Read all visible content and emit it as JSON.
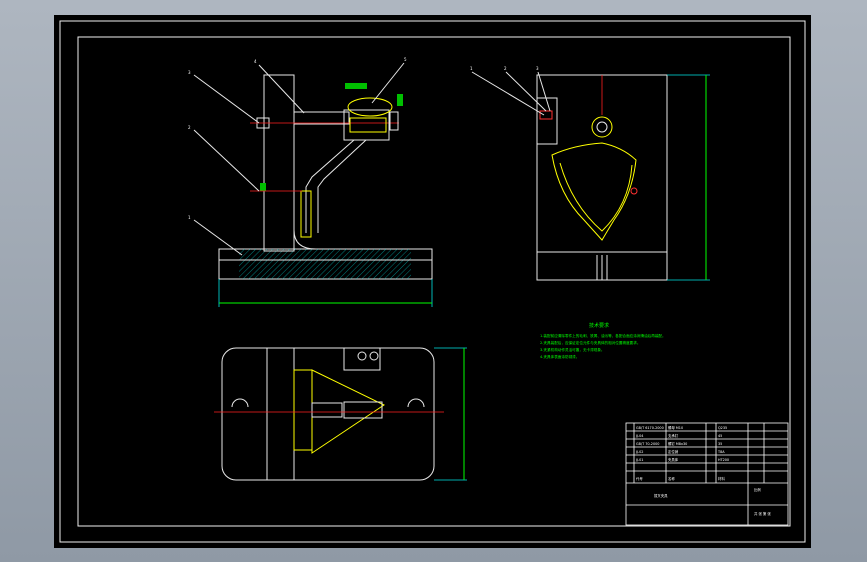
{
  "tech_requirements": {
    "title": "技术要求",
    "lines": [
      "1.装配前应清除零件上的毛刺、铁屑、油污等，各配合面应涂润滑油后再装配。",
      "2.夹具装配后，应保证定位元件与夹具体的相对位置精度要求。",
      "3.夹紧机构动作灵活可靠，无卡滞现象。",
      "4.夹具体表面涂防锈漆。"
    ]
  },
  "title_block": {
    "rows": [
      [
        "5",
        "GB/T 6170-2000",
        "螺母 M10",
        "1",
        "Q235"
      ],
      [
        "4",
        "JJ-04",
        "支承钉",
        "2",
        "45"
      ],
      [
        "3",
        "GB/T 70-2000",
        "螺钉 M8x30",
        "4",
        "35"
      ],
      [
        "2",
        "JJ-02",
        "定位销",
        "1",
        "T8A"
      ],
      [
        "1",
        "JJ-01",
        "夹具体",
        "1",
        "HT200"
      ]
    ],
    "header": [
      "序号",
      "代号",
      "名称",
      "数量",
      "材料"
    ],
    "drawing_name": "拨叉夹具",
    "scale_label": "比例",
    "sheet_label": "共 张 第 张"
  }
}
